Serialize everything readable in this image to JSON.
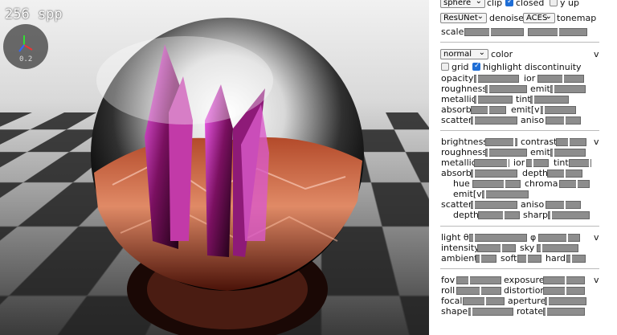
{
  "viewport": {
    "spp": "256 spp",
    "gizmo_value": "0.2"
  },
  "panel": {
    "top_row": {
      "shape_select": "sphere",
      "clip_label": "clip",
      "closed_label": "closed",
      "closed_checked": true,
      "yup_label": "y up",
      "yup_checked": false
    },
    "render_row": {
      "denoiser_select": "ResUNet",
      "denoise_label": "denoise",
      "tonemap_select": "ACES",
      "tonemap_label": "tonemap"
    },
    "scale_label": "scale",
    "material": {
      "mode_select": "normal",
      "color_label": "color",
      "chevron": "v",
      "grid_label": "grid",
      "grid_checked": false,
      "highlight_label": "highlight discontinuity",
      "highlight_checked": true,
      "opacity": "opacity",
      "ior": "ior",
      "roughness": "roughness",
      "emit": "emit",
      "metallic": "metallic",
      "tint": "tint",
      "absorb": "absorb",
      "emitv": "emit[v]",
      "scatter": "scatter",
      "aniso": "aniso"
    },
    "material2": {
      "brightness": "brightness",
      "contrast": "contrast",
      "chevron": "v",
      "roughness": "roughness",
      "emit": "emit",
      "metallic": "metallic",
      "ior": "ior",
      "tint": "tint",
      "absorb": "absorb",
      "depth": "depth",
      "hue": "hue",
      "chroma": "chroma",
      "emitv": "emit[v]",
      "scatter": "scatter",
      "aniso": "aniso",
      "depth2": "depth",
      "sharp": "sharp"
    },
    "lighting": {
      "light_theta": "light θ",
      "phi": "φ",
      "chevron": "v",
      "intensity": "intensity",
      "sky": "sky",
      "ambient": "ambient",
      "soft": "soft",
      "hard": "hard"
    },
    "camera": {
      "fov": "fov",
      "exposure": "exposure",
      "chevron": "v",
      "roll": "roll",
      "distortion": "distortion",
      "focal": "focal",
      "aperture": "aperture",
      "shape": "shape",
      "rotate": "rotate"
    }
  }
}
